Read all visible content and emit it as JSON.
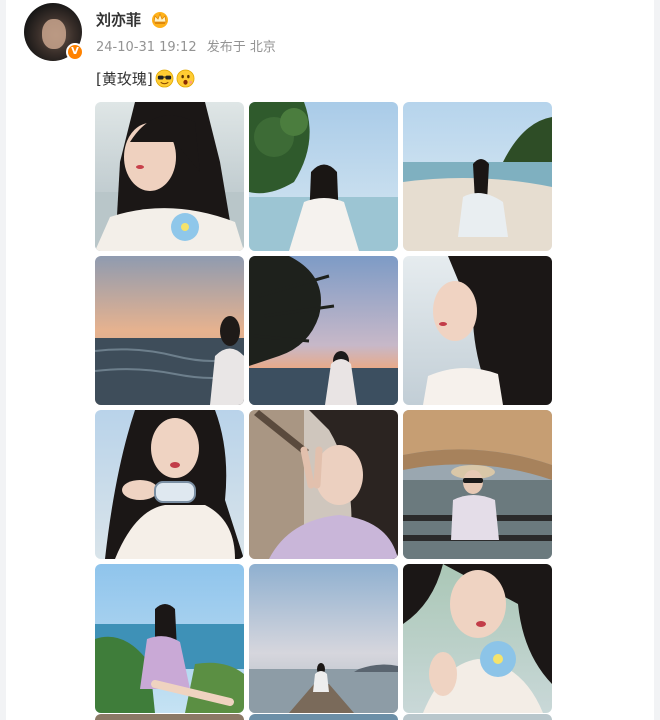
{
  "post": {
    "author": "刘亦菲",
    "date": "24-10-31 19:12",
    "source": "发布于 北京",
    "text": "[黄玫瑰]"
  },
  "verified_badge": "V",
  "icons": [
    "avatar",
    "verified-badge",
    "crown-icon",
    "sunglasses-emoji-icon",
    "surprised-emoji-icon"
  ],
  "photos": [
    {
      "scene": "portrait-beach-flower"
    },
    {
      "scene": "sitting-beach-tree"
    },
    {
      "scene": "sitting-on-sand"
    },
    {
      "scene": "sunset-sea"
    },
    {
      "scene": "tree-silhouette-sunset"
    },
    {
      "scene": "portrait-profile"
    },
    {
      "scene": "selfie-hair-clip"
    },
    {
      "scene": "peace-sign-selfie"
    },
    {
      "scene": "sunglasses-hat-balcony"
    },
    {
      "scene": "sitting-by-sea-purple"
    },
    {
      "scene": "sunset-boat"
    },
    {
      "scene": "closeup-flower"
    }
  ],
  "colors": {
    "accent_orange": "#ff8200",
    "meta_gray": "#939393",
    "text": "#333333"
  }
}
